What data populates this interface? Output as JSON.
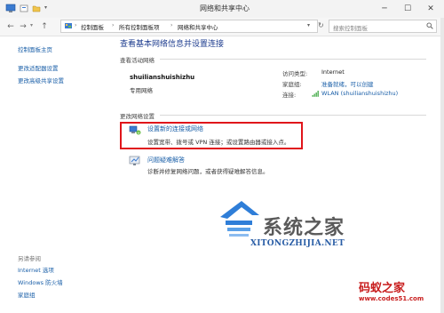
{
  "window": {
    "title": "网络和共享中心",
    "minimize": "─",
    "maximize": "☐",
    "close": "✕"
  },
  "nav": {
    "back": "←",
    "forward": "→",
    "up": "↑",
    "breadcrumb": [
      "控制面板",
      "所有控制面板项",
      "网络和共享中心"
    ],
    "search_placeholder": "搜索控制面板"
  },
  "left_pane": {
    "links": [
      "控制面板主页",
      "更改适配器设置",
      "更改高级共享设置"
    ],
    "see_also_heading": "另请参阅",
    "see_also": [
      "Internet 选项",
      "Windows 防火墙",
      "家庭组"
    ]
  },
  "main": {
    "title": "查看基本网络信息并设置连接",
    "active_heading": "查看活动网络",
    "network_name": "shuilianshuishizhu",
    "network_category": "专用网络",
    "access_type_label": "访问类型:",
    "access_type_value": "Internet",
    "homegroup_label": "家庭组:",
    "homegroup_value": "准备就绪，可以创建",
    "connection_label": "连接:",
    "connection_value": "WLAN (shuilianshuishizhu)",
    "change_heading": "更改网络设置",
    "setup_link": "设置新的连接或网络",
    "setup_desc": "设置宽带、拨号或 VPN 连接；或设置路由器或接入点。",
    "troubleshoot_link": "问题疑难解答",
    "troubleshoot_desc": "诊断并修复网络问题，或者获得疑难解答信息。"
  },
  "watermarks": {
    "brand1": "系统之家",
    "brand1_url": "XITONGZHIJIA.NET",
    "brand2": "码蚁之家",
    "brand2_url": "www.codes51.com"
  },
  "colors": {
    "link": "#1a5fa8",
    "title": "#1e3d8f",
    "highlight": "#e0151b"
  }
}
